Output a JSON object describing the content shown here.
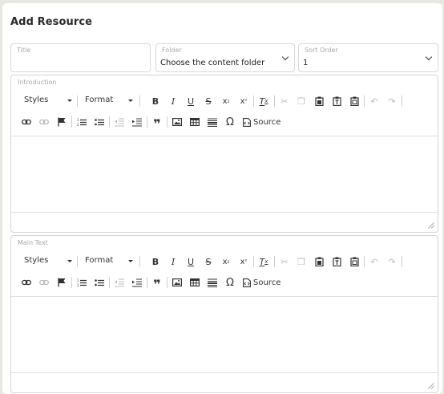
{
  "page": {
    "title": "Add Resource"
  },
  "fields": {
    "title": {
      "label": "Title",
      "value": ""
    },
    "folder": {
      "label": "Folder",
      "value": "Choose the content folder"
    },
    "sort_order": {
      "label": "Sort Order",
      "value": "1"
    }
  },
  "editors": [
    {
      "label": "Introduction",
      "styles_label": "Styles",
      "format_label": "Format",
      "source_label": "Source",
      "content": ""
    },
    {
      "label": "Main Text",
      "styles_label": "Styles",
      "format_label": "Format",
      "source_label": "Source",
      "content": ""
    }
  ],
  "colors": {
    "background": "#e8e7e1",
    "card": "#ffffff",
    "border": "#d9d9d9",
    "disabled_icon": "#bcbcbc"
  },
  "icons": [
    "bold-icon",
    "italic-icon",
    "underline-icon",
    "strikethrough-icon",
    "subscript-icon",
    "superscript-icon",
    "remove-format-icon",
    "cut-icon",
    "copy-icon",
    "paste-icon",
    "paste-text-icon",
    "paste-word-icon",
    "undo-icon",
    "redo-icon",
    "link-icon",
    "unlink-icon",
    "anchor-icon",
    "numbered-list-icon",
    "bulleted-list-icon",
    "outdent-icon",
    "indent-icon",
    "blockquote-icon",
    "image-icon",
    "table-icon",
    "horizontal-rule-icon",
    "special-char-icon",
    "source-icon",
    "resize-handle-icon"
  ]
}
